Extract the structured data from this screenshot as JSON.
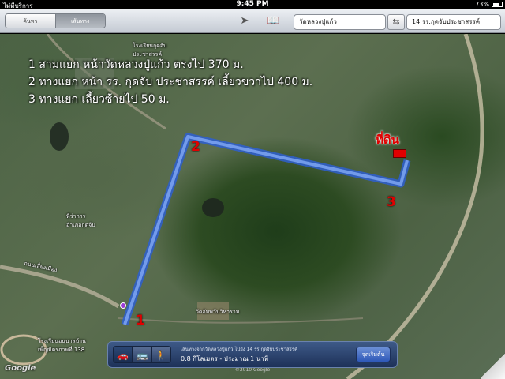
{
  "status": {
    "carrier": "ไม่มีบริการ",
    "time": "9:45 PM",
    "battery": "73%"
  },
  "toolbar": {
    "tabs": [
      "ค้นหา",
      "เส้นทาง"
    ],
    "active_tab": "เส้นทาง",
    "location_icon": "location-arrow-icon",
    "bookmarks_icon": "bookmarks-icon",
    "start_field": "วัดหลวงปู่แก้ว",
    "end_field": "14 รร.กุดจับประชาสรรค์",
    "swap_icon": "swap-icon"
  },
  "map": {
    "directions": [
      "1 สามแยก หน้าวัดหลวงปู่แก้ว ตรงไป 370 ม.",
      "2 ทางแยก หน้า รร. กุดจับ ประชาสรรค์ เลี้ยวขวาไป 400 ม.",
      "3 ทางแยก เลี้ยวซ้ายไป 50 ม."
    ],
    "step_numbers": [
      "1",
      "2",
      "3"
    ],
    "land_label": "ที่ดิน",
    "route_color": "#3d6fd8",
    "places": {
      "school_top": "โรงเรียนกุดจับ\nประชาสรรค์",
      "office": "ที่ว่าการ\nอำเภอกุดจับ",
      "road": "ถนนเลี่ยงเมือง",
      "temple": "วัดอัมพวันวิหาราม",
      "school_bottom": "โรงเรียนอนุบาลบ้าน\nเพ็ญมิตรภาพที่ 138"
    },
    "google_logo": "Google",
    "copyright": "©2010 Google"
  },
  "route_panel": {
    "modes": [
      "car-icon",
      "bus-icon",
      "walk-icon"
    ],
    "title": "เส้นทางจากวัดหลวงปู่แก้ว ไปยัง 14 รร.กุดจับประชาสรรค์",
    "distance": "0.8 กิโลเมตร - ประมาณ 1 นาที",
    "start_button": "จุดเริ่มต้น"
  }
}
